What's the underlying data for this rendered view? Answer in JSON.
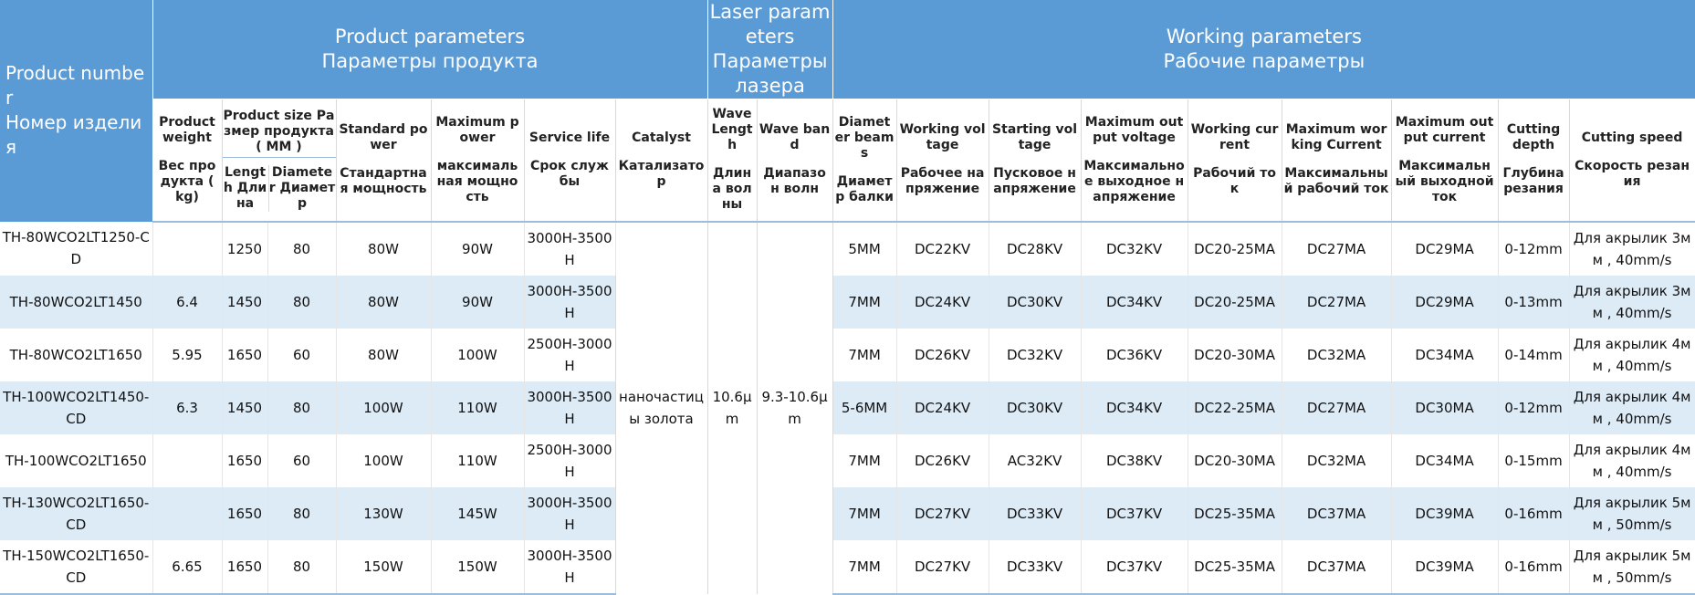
{
  "headers": {
    "product_number": "Product number\nНомер изделия",
    "group_product": "Product parameters\nПараметры продукта",
    "group_laser": "Laser parameters\nПараметры лазера",
    "group_working": "Working parameters\nРабочие параметры",
    "product_weight_en": "Product weight",
    "product_weight_ru": "Вес продукта ( kg)",
    "product_size": "Product size Размер продукта ( MM )",
    "length": "Length Длина",
    "diameter": "Diameter Диаметр",
    "standard_power_en": "Standard power",
    "standard_power_ru": "Стандартная мощность",
    "maximum_power_en": "Maximum power",
    "maximum_power_ru": "максимальная мощность",
    "service_life_en": "Service life",
    "service_life_ru": "Срок службы",
    "catalyst_en": "Catalyst",
    "catalyst_ru": "Катализатор",
    "wave_length_en": "Wave Length",
    "wave_length_ru": "Длина волны",
    "wave_band_en": "Wave band",
    "wave_band_ru": "Диапазон волн",
    "diameter_beams_en": "Diameter beams",
    "diameter_beams_ru": "Диаметр балки",
    "working_voltage_en": "Working voltage",
    "working_voltage_ru": "Рабочее напряжение",
    "starting_voltage_en": "Starting voltage",
    "starting_voltage_ru": "Пусковое напряжение",
    "max_output_voltage_en": "Maximum output voltage",
    "max_output_voltage_ru": "Максимальное выходное напряжение",
    "working_current_en": "Working current",
    "working_current_ru": "Рабочий ток",
    "max_working_current_en": "Maximum working Current",
    "max_working_current_ru": "Максимальный рабочий ток",
    "max_output_current_en": "Maximum output current",
    "max_output_current_ru": "Максимальный выходной ток",
    "cutting_depth_en": "Cutting depth",
    "cutting_depth_ru": "Глубина резания",
    "cutting_speed_en": "Cutting speed",
    "cutting_speed_ru": "Скорость резания"
  },
  "shared": {
    "catalyst": "наночастицы золота",
    "wave_length": "10.6μm",
    "wave_band": "9.3-10.6μm"
  },
  "rows": [
    {
      "model": "TH-80WCO2LT1250-CD",
      "weight": "",
      "length": "1250",
      "diameter": "80",
      "std_power": "80W",
      "max_power": "90W",
      "life": "3000H-3500H",
      "beam": "5MM",
      "work_v": "DC22KV",
      "start_v": "DC28KV",
      "max_out_v": "DC32KV",
      "work_i": "DC20-25MA",
      "max_work_i": "DC27MA",
      "max_out_i": "DC29MA",
      "depth": "0-12mm",
      "speed": "Для акрылик 3мм , 40mm/s"
    },
    {
      "model": "TH-80WCO2LT1450",
      "weight": "6.4",
      "length": "1450",
      "diameter": "80",
      "std_power": "80W",
      "max_power": "90W",
      "life": "3000H-3500H",
      "beam": "7MM",
      "work_v": "DC24KV",
      "start_v": "DC30KV",
      "max_out_v": "DC34KV",
      "work_i": "DC20-25MA",
      "max_work_i": "DC27MA",
      "max_out_i": "DC29MA",
      "depth": "0-13mm",
      "speed": "Для акрылик 3мм , 40mm/s"
    },
    {
      "model": "TH-80WCO2LT1650",
      "weight": "5.95",
      "length": "1650",
      "diameter": "60",
      "std_power": "80W",
      "max_power": "100W",
      "life": "2500H-3000H",
      "beam": "7MM",
      "work_v": "DC26KV",
      "start_v": "DC32KV",
      "max_out_v": "DC36KV",
      "work_i": "DC20-30MA",
      "max_work_i": "DC32MA",
      "max_out_i": "DC34MA",
      "depth": "0-14mm",
      "speed": "Для акрылик 4мм , 40mm/s"
    },
    {
      "model": "TH-100WCO2LT1450-CD",
      "weight": "6.3",
      "length": "1450",
      "diameter": "80",
      "std_power": "100W",
      "max_power": "110W",
      "life": "3000H-3500H",
      "beam": "5-6MM",
      "work_v": "DC24KV",
      "start_v": "DC30KV",
      "max_out_v": "DC34KV",
      "work_i": "DC22-25MA",
      "max_work_i": "DC27MA",
      "max_out_i": "DC30MA",
      "depth": "0-12mm",
      "speed": "Для акрылик 4мм , 40mm/s"
    },
    {
      "model": "TH-100WCO2LT1650",
      "weight": "",
      "length": "1650",
      "diameter": "60",
      "std_power": "100W",
      "max_power": "110W",
      "life": "2500H-3000H",
      "beam": "7MM",
      "work_v": "DC26KV",
      "start_v": "AC32KV",
      "max_out_v": "DC38KV",
      "work_i": "DC20-30MA",
      "max_work_i": "DC32MA",
      "max_out_i": "DC34MA",
      "depth": "0-15mm",
      "speed": "Для акрылик 4мм , 40mm/s"
    },
    {
      "model": "TH-130WCO2LT1650-CD",
      "weight": "",
      "length": "1650",
      "diameter": "80",
      "std_power": "130W",
      "max_power": "145W",
      "life": "3000H-3500H",
      "beam": "7MM",
      "work_v": "DC27KV",
      "start_v": "DC33KV",
      "max_out_v": "DC37KV",
      "work_i": "DC25-35MA",
      "max_work_i": "DC37MA",
      "max_out_i": "DC39MA",
      "depth": "0-16mm",
      "speed": "Для акрылик 5мм , 50mm/s"
    },
    {
      "model": "TH-150WCO2LT1650-CD",
      "weight": "6.65",
      "length": "1650",
      "diameter": "80",
      "std_power": "150W",
      "max_power": "150W",
      "life": "3000H-3500H",
      "beam": "7MM",
      "work_v": "DC27KV",
      "start_v": "DC33KV",
      "max_out_v": "DC37KV",
      "work_i": "DC25-35MA",
      "max_work_i": "DC37MA",
      "max_out_i": "DC39MA",
      "depth": "0-16mm",
      "speed": "Для акрылик 5мм , 50mm/s"
    }
  ]
}
